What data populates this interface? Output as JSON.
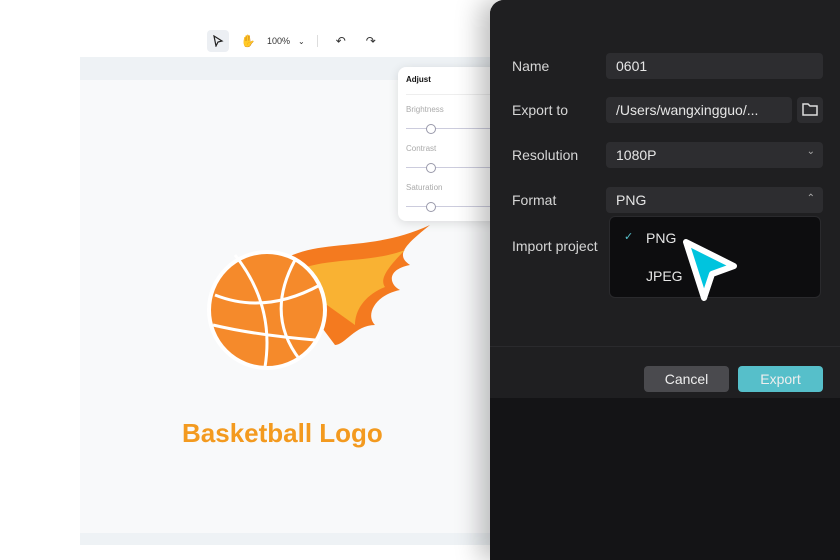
{
  "toolbar": {
    "zoom": "100%"
  },
  "canvas": {
    "title": "Basketball Logo"
  },
  "adjust": {
    "title": "Adjust",
    "items": [
      "Brightness",
      "Contrast",
      "Saturation"
    ]
  },
  "export": {
    "name_label": "Name",
    "name_value": "0601",
    "export_to_label": "Export to",
    "export_to_value": "/Users/wangxingguo/...",
    "resolution_label": "Resolution",
    "resolution_value": "1080P",
    "format_label": "Format",
    "format_value": "PNG",
    "import_label": "Import project",
    "format_options": [
      "PNG",
      "JPEG"
    ],
    "selected_option": "PNG",
    "cancel": "Cancel",
    "export": "Export",
    "accent": "#56bfca"
  }
}
